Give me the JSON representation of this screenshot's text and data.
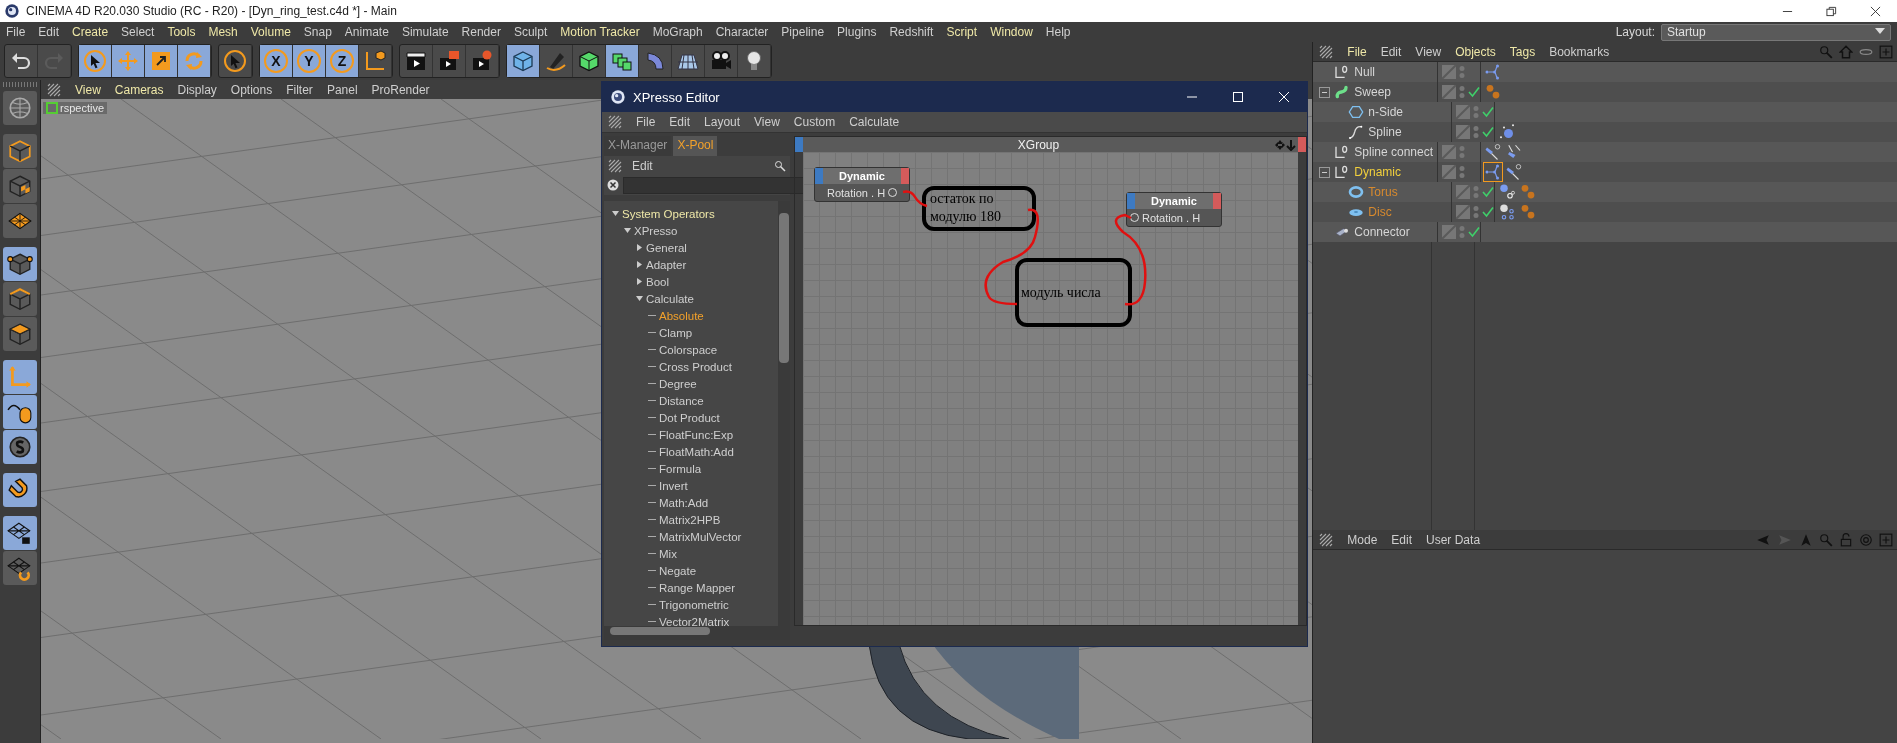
{
  "window": {
    "title": "CINEMA 4D R20.030 Studio (RC - R20) - [Dyn_ring_test.c4d *] - Main"
  },
  "menu": [
    {
      "label": "File",
      "highlighted": false
    },
    {
      "label": "Edit",
      "highlighted": false
    },
    {
      "label": "Create",
      "highlighted": true
    },
    {
      "label": "Select",
      "highlighted": false
    },
    {
      "label": "Tools",
      "highlighted": true
    },
    {
      "label": "Mesh",
      "highlighted": true
    },
    {
      "label": "Volume",
      "highlighted": true
    },
    {
      "label": "Snap",
      "highlighted": false
    },
    {
      "label": "Animate",
      "highlighted": false
    },
    {
      "label": "Simulate",
      "highlighted": false
    },
    {
      "label": "Render",
      "highlighted": false
    },
    {
      "label": "Sculpt",
      "highlighted": false
    },
    {
      "label": "Motion Tracker",
      "highlighted": true
    },
    {
      "label": "MoGraph",
      "highlighted": false
    },
    {
      "label": "Character",
      "highlighted": false
    },
    {
      "label": "Pipeline",
      "highlighted": false
    },
    {
      "label": "Plugins",
      "highlighted": false
    },
    {
      "label": "Redshift",
      "highlighted": false
    },
    {
      "label": "Script",
      "highlighted": true
    },
    {
      "label": "Window",
      "highlighted": true
    },
    {
      "label": "Help",
      "highlighted": false
    }
  ],
  "layout": {
    "label": "Layout:",
    "value": "Startup"
  },
  "toolbar": [
    [
      {
        "kind": "undo",
        "active": false,
        "disabled": false
      },
      {
        "kind": "redo",
        "active": false,
        "disabled": true
      }
    ],
    [
      {
        "kind": "select",
        "active": true,
        "disabled": false
      },
      {
        "kind": "move",
        "active": true,
        "disabled": false
      },
      {
        "kind": "scale",
        "active": true,
        "disabled": false
      },
      {
        "kind": "rotate",
        "active": true,
        "disabled": false
      }
    ],
    [
      {
        "kind": "select",
        "active": false,
        "disabled": false
      }
    ],
    [
      {
        "kind": "axis",
        "label": "X",
        "active": true,
        "disabled": false
      },
      {
        "kind": "axis",
        "label": "Y",
        "active": true,
        "disabled": false
      },
      {
        "kind": "axis",
        "label": "Z",
        "active": true,
        "disabled": false
      },
      {
        "kind": "coords",
        "active": false,
        "disabled": false
      }
    ],
    [
      {
        "kind": "render-view",
        "active": false,
        "disabled": false
      },
      {
        "kind": "render-pv",
        "active": false,
        "disabled": false
      },
      {
        "kind": "render-settings",
        "active": false,
        "disabled": false
      }
    ],
    [
      {
        "kind": "cube",
        "active": true,
        "disabled": false
      },
      {
        "kind": "pen",
        "active": false,
        "disabled": false
      },
      {
        "kind": "subdiv",
        "active": false,
        "disabled": false
      },
      {
        "kind": "clone",
        "active": true,
        "disabled": false
      },
      {
        "kind": "deformer",
        "active": false,
        "disabled": false
      },
      {
        "kind": "floor",
        "active": false,
        "disabled": false
      },
      {
        "kind": "camera",
        "active": false,
        "disabled": false
      },
      {
        "kind": "light",
        "active": false,
        "disabled": false
      }
    ]
  ],
  "left_tools": [
    {
      "kind": "globe",
      "active": false
    },
    {
      "kind": "model",
      "active": false
    },
    {
      "kind": "texture",
      "active": false
    },
    {
      "kind": "workplane",
      "active": false
    },
    {
      "kind": "points",
      "active": true
    },
    {
      "kind": "edges",
      "active": false
    },
    {
      "kind": "polygons",
      "active": false
    },
    {
      "kind": "axes",
      "active": true
    },
    {
      "kind": "tweak",
      "active": true
    },
    {
      "kind": "solo",
      "active": true
    },
    {
      "kind": "snap",
      "active": true
    },
    {
      "kind": "lock",
      "active": true
    },
    {
      "kind": "align",
      "active": false
    }
  ],
  "viewport": {
    "menu": [
      {
        "label": "View",
        "highlighted": true
      },
      {
        "label": "Cameras",
        "highlighted": true
      },
      {
        "label": "Display",
        "highlighted": false
      },
      {
        "label": "Options",
        "highlighted": false
      },
      {
        "label": "Filter",
        "highlighted": false
      },
      {
        "label": "Panel",
        "highlighted": false
      },
      {
        "label": "ProRender",
        "highlighted": false
      }
    ],
    "camera": "rspective"
  },
  "xpresso": {
    "title": "XPresso Editor",
    "menu": [
      "File",
      "Edit",
      "Layout",
      "View",
      "Custom",
      "Calculate"
    ],
    "tabs": [
      {
        "label": "X-Manager",
        "selected": false
      },
      {
        "label": "X-Pool",
        "selected": true
      }
    ],
    "pool_menu": "Edit",
    "tree": [
      {
        "label": "System Operators",
        "expanded": true,
        "selected": false,
        "children": [
          {
            "label": "XPresso",
            "expanded": true,
            "selected": false,
            "children": [
              {
                "label": "General",
                "expanded": false,
                "selected": false
              },
              {
                "label": "Adapter",
                "expanded": false,
                "selected": false
              },
              {
                "label": "Bool",
                "expanded": false,
                "selected": false
              },
              {
                "label": "Calculate",
                "expanded": true,
                "selected": false,
                "children": [
                  {
                    "label": "Absolute",
                    "selected": true
                  },
                  {
                    "label": "Clamp",
                    "selected": false
                  },
                  {
                    "label": "Colorspace",
                    "selected": false
                  },
                  {
                    "label": "Cross Product",
                    "selected": false
                  },
                  {
                    "label": "Degree",
                    "selected": false
                  },
                  {
                    "label": "Distance",
                    "selected": false
                  },
                  {
                    "label": "Dot Product",
                    "selected": false
                  },
                  {
                    "label": "FloatFunc:Exp",
                    "selected": false
                  },
                  {
                    "label": "FloatMath:Add",
                    "selected": false
                  },
                  {
                    "label": "Formula",
                    "selected": false
                  },
                  {
                    "label": "Invert",
                    "selected": false
                  },
                  {
                    "label": "Math:Add",
                    "selected": false
                  },
                  {
                    "label": "Matrix2HPB",
                    "selected": false
                  },
                  {
                    "label": "MatrixMulVector",
                    "selected": false
                  },
                  {
                    "label": "Mix",
                    "selected": false
                  },
                  {
                    "label": "Negate",
                    "selected": false
                  },
                  {
                    "label": "Range Mapper",
                    "selected": false
                  },
                  {
                    "label": "Trigonometric",
                    "selected": false
                  },
                  {
                    "label": "Vector2Matrix",
                    "selected": false
                  }
                ]
              }
            ]
          }
        ]
      }
    ],
    "group": "XGroup",
    "nodes": [
      {
        "title": "Dynamic",
        "port": "Rotation . H",
        "kind": "output"
      },
      {
        "title": "Dynamic",
        "port": "Rotation . H",
        "kind": "input"
      }
    ],
    "notes": [
      "остаток по модулю 180",
      "модуль числа"
    ]
  },
  "objects": {
    "menu": [
      {
        "label": "File",
        "highlighted": true
      },
      {
        "label": "Edit",
        "highlighted": false
      },
      {
        "label": "View",
        "highlighted": false
      },
      {
        "label": "Objects",
        "highlighted": true
      },
      {
        "label": "Tags",
        "highlighted": true
      },
      {
        "label": "Bookmarks",
        "highlighted": false
      }
    ],
    "items": [
      {
        "name": "Null",
        "kind": "null",
        "enabled": false,
        "selected": false,
        "tags": [
          {
            "kind": "xpresso",
            "selected": false
          }
        ]
      },
      {
        "name": "Sweep",
        "kind": "sweep",
        "enabled": true,
        "selected": false,
        "expanded": true,
        "tags": [
          {
            "kind": "material",
            "selected": false
          }
        ],
        "children": [
          {
            "name": "n-Side",
            "kind": "nside",
            "enabled": true,
            "selected": false
          },
          {
            "name": "Spline",
            "kind": "spline",
            "enabled": true,
            "selected": false,
            "tags": [
              {
                "kind": "spline-tag",
                "selected": false
              }
            ]
          }
        ]
      },
      {
        "name": "Spline connect",
        "kind": "null",
        "enabled": false,
        "selected": false,
        "tags": [
          {
            "kind": "constraint",
            "selected": false
          },
          {
            "kind": "pin",
            "selected": false
          }
        ]
      },
      {
        "name": "Dynamic",
        "kind": "null",
        "enabled": false,
        "selected": true,
        "expanded": true,
        "tags": [
          {
            "kind": "xpresso",
            "selected": true
          },
          {
            "kind": "constraint",
            "selected": false
          }
        ],
        "children": [
          {
            "name": "Torus",
            "kind": "torus",
            "enabled": true,
            "selected": false,
            "tags": [
              {
                "kind": "dynamics",
                "selected": false
              },
              {
                "kind": "material",
                "selected": false
              }
            ]
          },
          {
            "name": "Disc",
            "kind": "disc",
            "enabled": true,
            "selected": false,
            "tags": [
              {
                "kind": "collider",
                "selected": false
              },
              {
                "kind": "material",
                "selected": false
              }
            ]
          }
        ]
      },
      {
        "name": "Connector",
        "kind": "connector",
        "enabled": true,
        "selected": false
      }
    ]
  },
  "attributes": {
    "menu": [
      "Mode",
      "Edit",
      "User Data"
    ]
  }
}
